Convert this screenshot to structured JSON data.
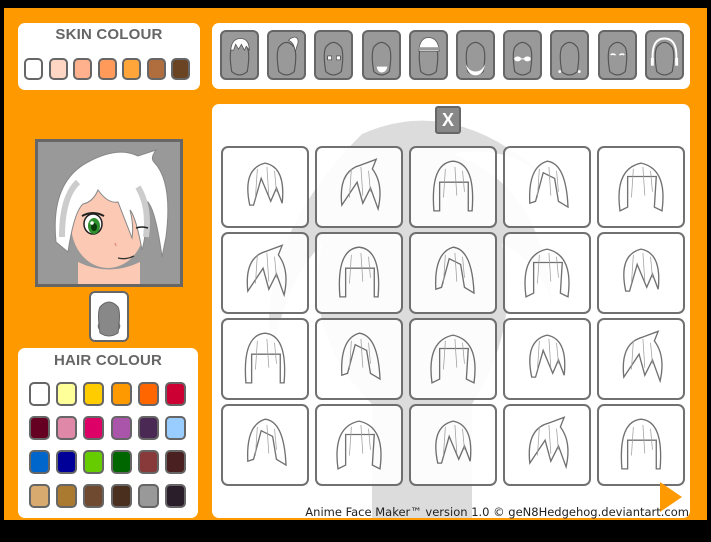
{
  "app": {
    "title": "Anime Face Maker"
  },
  "skin_panel": {
    "title": "SKIN COLOUR",
    "swatches": [
      "#ffffff",
      "#ffd5c4",
      "#ffb08c",
      "#ff9a5a",
      "#ffa53a",
      "#b06e3e",
      "#6b4424"
    ]
  },
  "categories": [
    {
      "name": "hair",
      "icon": "hair-icon"
    },
    {
      "name": "back-hair",
      "icon": "ponytail-icon"
    },
    {
      "name": "eyes",
      "icon": "eyes-icon"
    },
    {
      "name": "mouth",
      "icon": "mouth-icon"
    },
    {
      "name": "hat",
      "icon": "hat-icon"
    },
    {
      "name": "beard",
      "icon": "beard-icon"
    },
    {
      "name": "glasses",
      "icon": "glasses-icon"
    },
    {
      "name": "earrings",
      "icon": "earrings-icon"
    },
    {
      "name": "eyebrows",
      "icon": "eyebrows-icon"
    },
    {
      "name": "headphones",
      "icon": "headphones-icon"
    }
  ],
  "preview": {
    "label": "character-preview"
  },
  "face_shape_button": {
    "icon": "face-shape-icon"
  },
  "hair_panel": {
    "title": "HAIR COLOUR",
    "swatches": [
      "#ffffff",
      "#ffff99",
      "#ffcc00",
      "#ff9900",
      "#ff6600",
      "#cc0033",
      "#660022",
      "#e088a8",
      "#dd0066",
      "#aa55aa",
      "#4a2a55",
      "#99ccff",
      "#0066cc",
      "#000099",
      "#66cc00",
      "#006600",
      "#883a3a",
      "#4a2020",
      "#d8aa70",
      "#aa7a30",
      "#704a30",
      "#4a2e1e",
      "#999999",
      "#2a1e2a"
    ]
  },
  "selection_panel": {
    "clear_label": "X",
    "item_count": 20,
    "next_icon": "next-arrow-icon"
  },
  "footer": {
    "text": "Anime Face Maker™ version 1.0 © geN8Hedgehog.deviantart.com"
  }
}
